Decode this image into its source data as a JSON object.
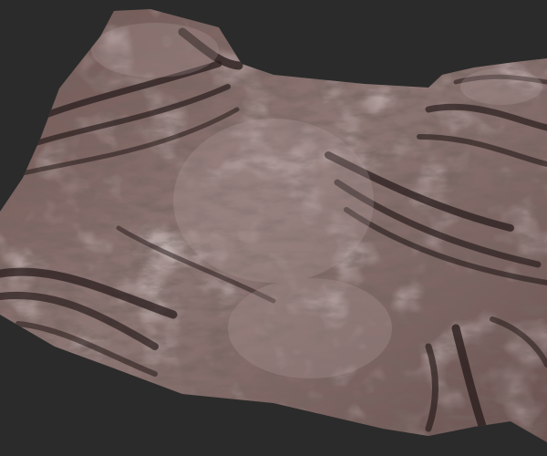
{
  "scene": {
    "subject": "terrain-mesh",
    "colors": {
      "background": "#2b2b2b",
      "rock_base": "#7a5e5a",
      "rock_light": "#a89290",
      "rock_dark": "#2e2222",
      "strata": "#3a2a28"
    }
  }
}
